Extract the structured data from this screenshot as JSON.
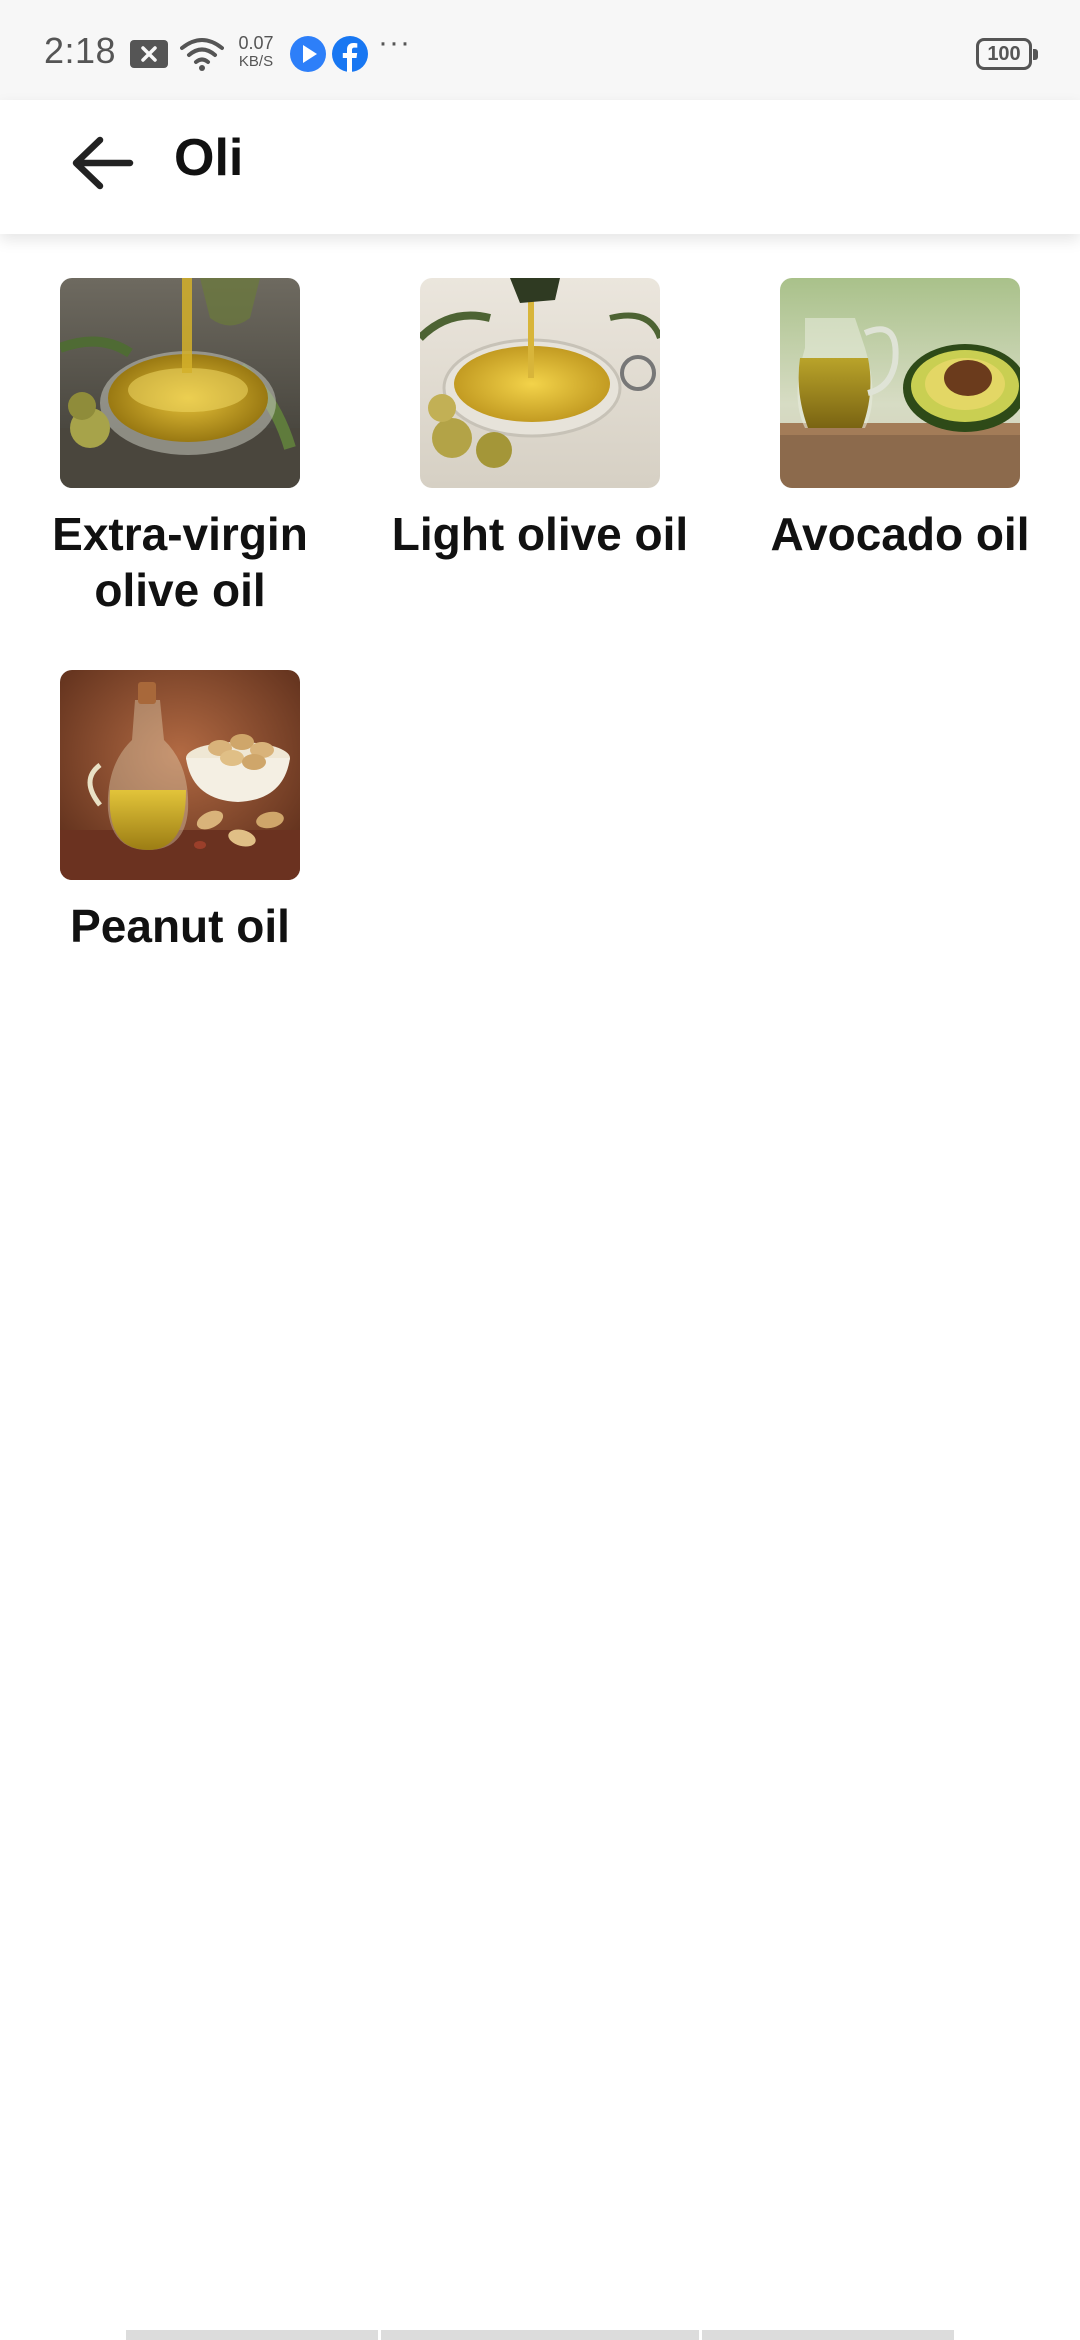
{
  "status_bar": {
    "time": "2:18",
    "net_speed_value": "0.07",
    "net_speed_unit": "KB/S",
    "more": "···",
    "battery": "100",
    "icons": [
      "notification-icon",
      "wifi-icon",
      "play-icon",
      "facebook-icon"
    ]
  },
  "app_bar": {
    "back_icon": "arrow-left-icon",
    "title": "Oli"
  },
  "items": [
    {
      "label": "Extra-virgin\nolive oil",
      "image": "olive-oil-bowl-image"
    },
    {
      "label": "Light olive oil",
      "image": "light-olive-oil-image"
    },
    {
      "label": "Avocado oil",
      "image": "avocado-oil-image"
    },
    {
      "label": "Peanut oil",
      "image": "peanut-oil-image"
    }
  ],
  "colors": {
    "status_bar_bg": "#f7f7f7",
    "app_bg": "#ffffff",
    "text": "#111111",
    "accent_blue": "#2d7ff9",
    "facebook_blue": "#1877f2"
  }
}
